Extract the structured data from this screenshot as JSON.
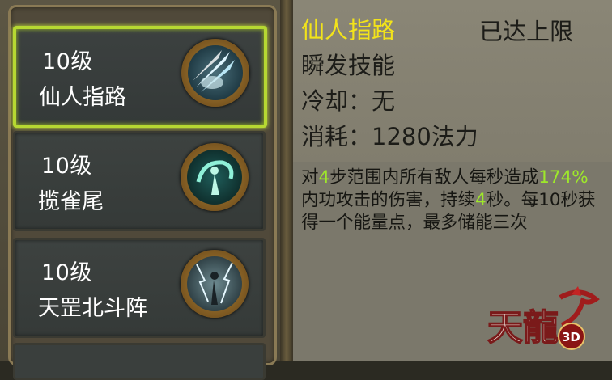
{
  "skills": [
    {
      "level": "10级",
      "name": "仙人指路",
      "icon": "sword-slash-icon",
      "selected": true
    },
    {
      "level": "10级",
      "name": "揽雀尾",
      "icon": "wind-swirl-icon",
      "selected": false
    },
    {
      "level": "10级",
      "name": "天罡北斗阵",
      "icon": "lightning-figure-icon",
      "selected": false
    }
  ],
  "detail": {
    "title": "仙人指路",
    "limit": "已达上限",
    "type": "瞬发技能",
    "cooldown": "冷却：无",
    "cost": "消耗：1280法力"
  },
  "description": {
    "p1": "对",
    "v1": "4",
    "p2": "步范围内所有敌人每秒造成",
    "v2": "174%",
    "p3": "内功攻击的伤害，持续",
    "v3": "4",
    "p4": "秒。每10秒获得一个能量点，最多储能三次"
  },
  "logo": {
    "main": "天龍",
    "badge": "3D",
    "icon": "dragon-logo-icon"
  },
  "colors": {
    "highlight": "#9ee82a",
    "title": "#f2e31a",
    "selected_border": "#b6d832"
  }
}
